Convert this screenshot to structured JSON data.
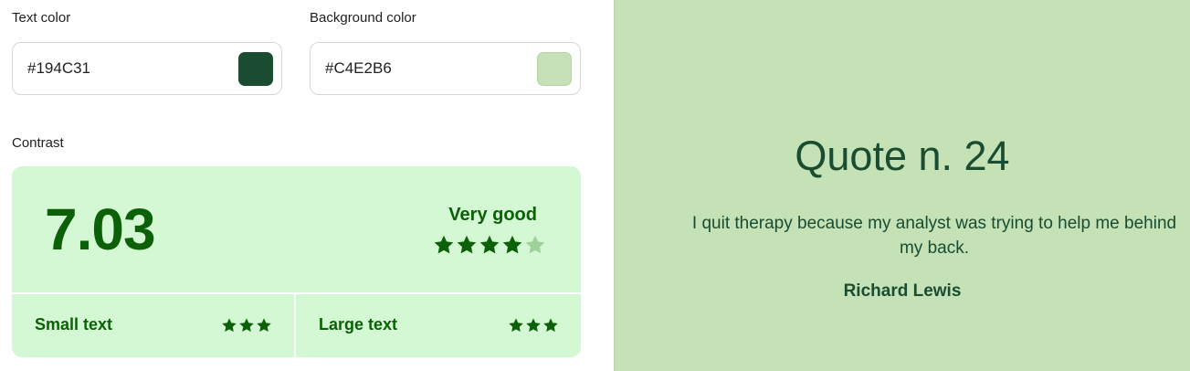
{
  "text_color": {
    "label": "Text color",
    "value": "#194C31",
    "swatch": "#194C31"
  },
  "background_color": {
    "label": "Background color",
    "value": "#C4E2B6",
    "swatch": "#C4E2B6"
  },
  "contrast": {
    "label": "Contrast",
    "ratio": "7.03",
    "rating": "Very good",
    "stars_filled": 4,
    "stars_total": 5,
    "small_text": {
      "label": "Small text",
      "stars": 3
    },
    "large_text": {
      "label": "Large text",
      "stars": 3
    }
  },
  "preview": {
    "title": "Quote n. 24",
    "body": "I quit therapy because my analyst was trying to help me behind my back.",
    "author": "Richard Lewis"
  },
  "colors": {
    "card_bg": "#d3f8d3",
    "card_text": "#0c6008",
    "star_filled": "#0c6008",
    "star_empty": "#9fd19b",
    "preview_bg": "#c4e2b6",
    "preview_text": "#194c31"
  },
  "icons": {
    "star": "star-icon"
  }
}
